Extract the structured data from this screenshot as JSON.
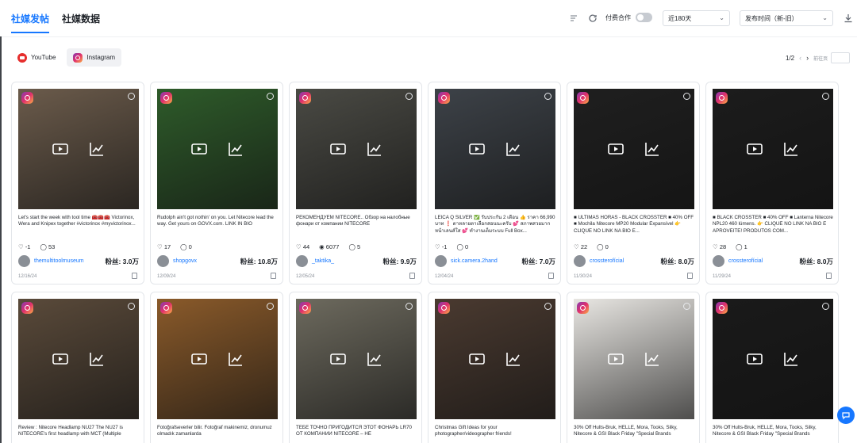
{
  "tabs": [
    {
      "label": "社媒发帖",
      "active": true
    },
    {
      "label": "社媒数据",
      "active": false
    }
  ],
  "toolbar": {
    "paid_label": "付费合作",
    "range_select": "近180天",
    "sort_select": "发布时间（新-旧）"
  },
  "platforms": [
    {
      "label": "YouTube",
      "icon": "youtube-icon",
      "selected": false
    },
    {
      "label": "Instagram",
      "icon": "instagram-icon",
      "selected": true
    }
  ],
  "pager": {
    "label": "1/2",
    "goto": "前往页"
  },
  "colors": {
    "accent": "#1677ff",
    "instagram": "#e1306c"
  },
  "posts": [
    {
      "caption": "Let's start the week with tool time 🧰🧰🧰 Victorinox, Wera and Knipex together #victorinox #myvictorinox...",
      "likes": "-1",
      "views": "",
      "comments": "53",
      "handle": "themultitoolmuseum",
      "fans": "粉丝: 3.0万",
      "date": "12/16/24",
      "bg": "#6b5b4b"
    },
    {
      "caption": "Rudolph ain't got nothin' on you. Let Nitecore lead the way. Get yours on GOVX.com. LINK IN BIO",
      "likes": "17",
      "views": "",
      "comments": "0",
      "handle": "shopgovx",
      "fans": "粉丝: 10.8万",
      "date": "12/09/24",
      "bg": "#2e5b2a"
    },
    {
      "caption": "РЕКОМЕНДУЕМ NITECORE.. Обзор на налобные фонари от компании NITECORE",
      "likes": "44",
      "views": "6077",
      "comments": "5",
      "handle": "_taktika_",
      "fans": "粉丝: 9.9万",
      "date": "12/05/24",
      "bg": "#4a4a44"
    },
    {
      "caption": "LEICA Q SILVER ✅ รับประกัน 2 เดือน 👍 ราคา 66,990 บาท ❗ ตาหลายตาเลือกสอนนะครับ 💕 สภาพสวยมาก หน้าเลนส์ใส 💕 ทำงานเต็มระบบ Full Box...",
      "likes": "-1",
      "views": "",
      "comments": "0",
      "handle": "sick.camera.2hand",
      "fans": "粉丝: 7.0万",
      "date": "12/04/24",
      "bg": "#3d4248"
    },
    {
      "caption": "■ ÚLTIMAS HORAS - BLACK CROSSTER ■ 40% OFF ■ Mochila Nitecore MP20 Modular Expansível 👉 CLIQUE NO LINK NA BIO E...",
      "likes": "22",
      "views": "",
      "comments": "0",
      "handle": "crossterofícial",
      "fans": "粉丝: 8.0万",
      "date": "11/30/24",
      "bg": "#1f1f1f"
    },
    {
      "caption": "■ BLACK CROSSTER ■ 40% OFF ■ Lanterna Nitecore NPL20 460 lúmens. 👉 CLIQUE NO LINK NA BIO E APROVEITE! PRODUTOS COM...",
      "likes": "28",
      "views": "",
      "comments": "1",
      "handle": "crossterofícial",
      "fans": "粉丝: 8.0万",
      "date": "11/29/24",
      "bg": "#1c1c1c"
    },
    {
      "caption": "Review : Nitecore Headlamp NU27 The NU27 is NITECORE's first headlamp with MCT (Multiple",
      "likes": "",
      "views": "",
      "comments": "",
      "handle": "",
      "fans": "",
      "date": "",
      "bg": "#5a4a3a"
    },
    {
      "caption": "Fotoğrafseverler bilir. Fotoğraf makinemiz, dronumuz olmadık zamanlarda",
      "likes": "",
      "views": "",
      "comments": "",
      "handle": "",
      "fans": "",
      "date": "",
      "bg": "#8a5a2a"
    },
    {
      "caption": "ТЕБЕ ТОЧНО ПРИГОДИТСЯ ЭТОТ ФОНАРЬ LR70 ОТ КОМПАНИИ NITECORE – НЕ",
      "likes": "",
      "views": "",
      "comments": "",
      "handle": "",
      "fans": "",
      "date": "",
      "bg": "#6d6a5e"
    },
    {
      "caption": "Christmas Gift Ideas for your photographer/videographer friends!",
      "likes": "",
      "views": "",
      "comments": "",
      "handle": "",
      "fans": "",
      "date": "",
      "bg": "#4a3a30"
    },
    {
      "caption": "30% Off Hults-Bruk, HELLE, Mora, Tooks, Silky, Nitecore & GSI Black Friday \"Special Brands",
      "likes": "",
      "views": "",
      "comments": "",
      "handle": "",
      "fans": "",
      "date": "",
      "bg": "#e8e6e2"
    },
    {
      "caption": "30% Off Hults-Bruk, HELLE, Mora, Tooks, Silky, Nitecore & GSI Black Friday \"Special Brands",
      "likes": "",
      "views": "",
      "comments": "",
      "handle": "",
      "fans": "",
      "date": "",
      "bg": "#1a1a1a"
    }
  ]
}
